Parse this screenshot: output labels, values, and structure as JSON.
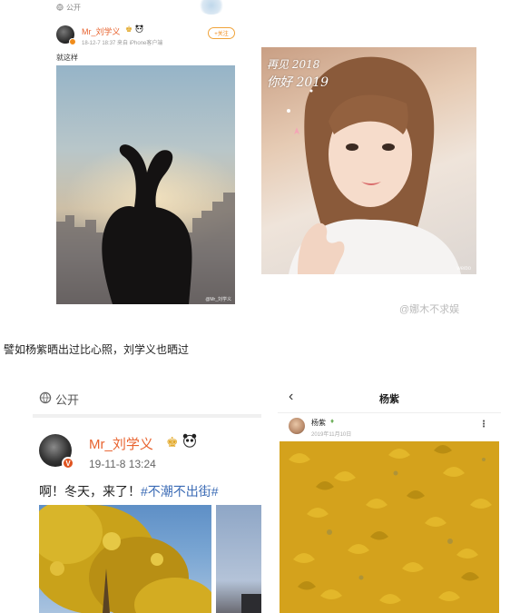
{
  "top_post": {
    "privacy": "公开",
    "username": "Mr_刘学义",
    "meta": "18-12-7 18:37  来自 iPhone客户端",
    "follow_label": "+关注",
    "text": "就这样",
    "watermark": "@Mr_刘学义"
  },
  "right_photo": {
    "overlay_line1": "再见 2018",
    "overlay_line2": "你好 2019",
    "watermark": "weibo"
  },
  "credit_watermark": "@娜木不求娱",
  "mid_caption": "譬如杨紫晒出过比心照，刘学义也晒过",
  "bottom_left_post": {
    "privacy": "公开",
    "username": "Mr_刘学义",
    "timestamp": "19-11-8 13:24",
    "text": "啊！冬天，来了！",
    "hashtag": "#不潮不出街#"
  },
  "bottom_right_screen": {
    "back_label": "‹",
    "page_title": "杨紫",
    "username": "杨紫",
    "date": "2019年11月10日",
    "more_label": "⋮"
  },
  "colors": {
    "brand_orange": "#e8632f",
    "hashtag_blue": "#3b6bb5",
    "ginkgo_yellow": "#d4a21c"
  },
  "icons": [
    "globe-icon",
    "crown-icon",
    "panda-icon",
    "verified-badge-icon",
    "back-arrow-icon",
    "more-icon",
    "vip-diamond-icon"
  ]
}
